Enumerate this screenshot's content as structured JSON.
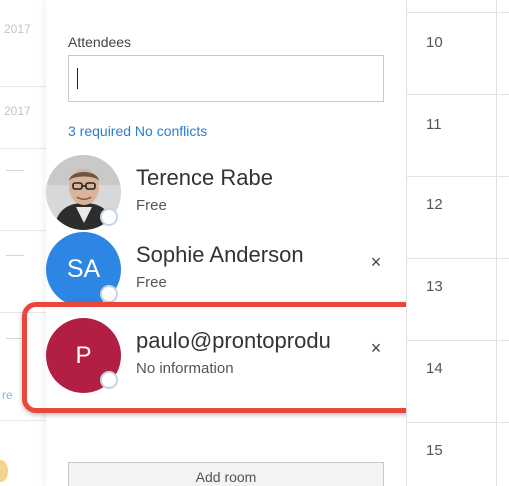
{
  "background_calendar": {
    "year_fragments": [
      "2017",
      "2017"
    ],
    "link_fragment": "re"
  },
  "attendees": {
    "label": "Attendees",
    "input_value": "",
    "status": "3 required No conflicts",
    "people": [
      {
        "name": "Terence Rabe",
        "status": "Free",
        "avatar": "photo",
        "removable": false
      },
      {
        "name": "Sophie Anderson",
        "status": "Free",
        "avatar": "initials",
        "initials": "SA",
        "removable": true
      },
      {
        "name": "paulo@prontoprodu",
        "status": "No information",
        "avatar": "initials",
        "initials": "P",
        "removable": true
      }
    ],
    "remove_icon": "×",
    "add_room_label": "Add room"
  },
  "timeline": {
    "hours": [
      "10",
      "11",
      "12",
      "13",
      "14",
      "15"
    ]
  },
  "colors": {
    "accent_link": "#2a7dd1",
    "avatar_sa": "#2d86e3",
    "avatar_p": "#b31e43",
    "highlight": "#e8473d"
  }
}
